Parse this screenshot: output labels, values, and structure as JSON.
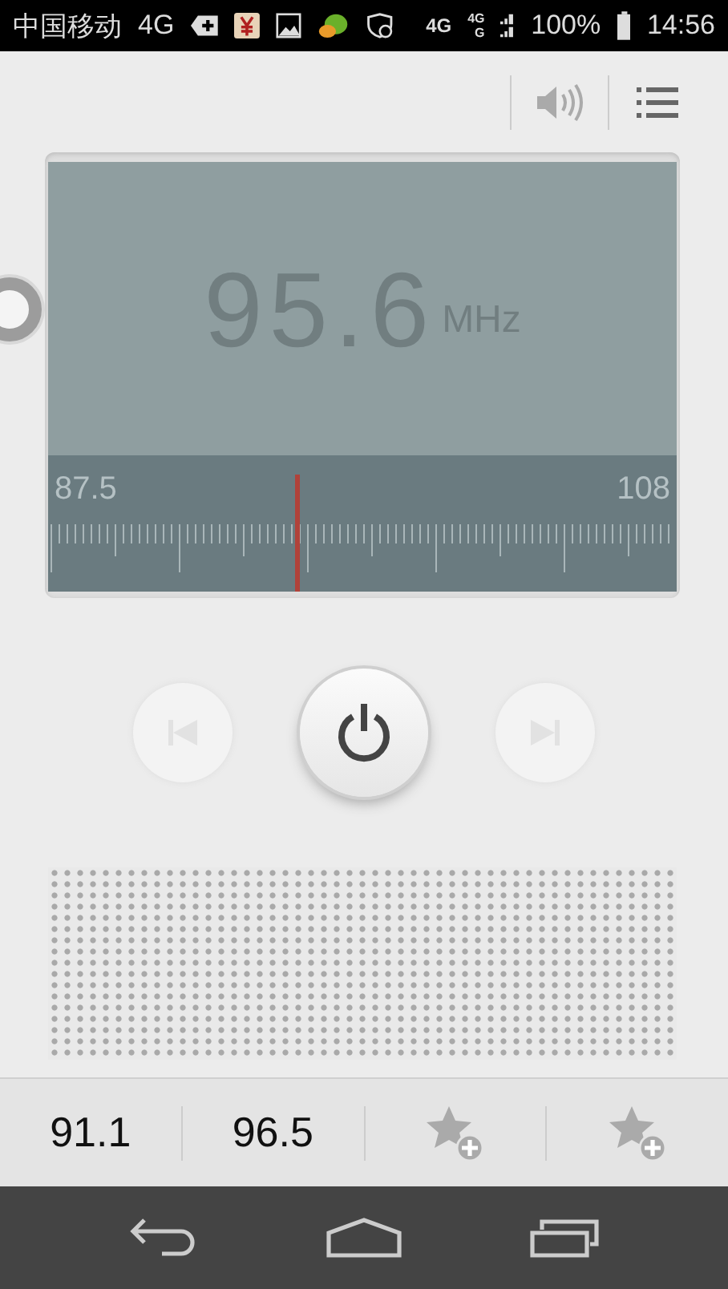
{
  "status_bar": {
    "carrier": "中国移动",
    "network": "4G",
    "signal_network": "4G",
    "signal_sim1": "4G",
    "signal_sim2": "G",
    "battery": "100%",
    "time": "14:56"
  },
  "display": {
    "frequency": "95.6",
    "unit": "MHz",
    "range_min": "87.5",
    "range_max": "108",
    "level": 0.395
  },
  "power": {
    "on": true
  },
  "presets": [
    {
      "kind": "station",
      "label": "91.1"
    },
    {
      "kind": "station",
      "label": "96.5"
    },
    {
      "kind": "empty"
    },
    {
      "kind": "empty"
    }
  ]
}
